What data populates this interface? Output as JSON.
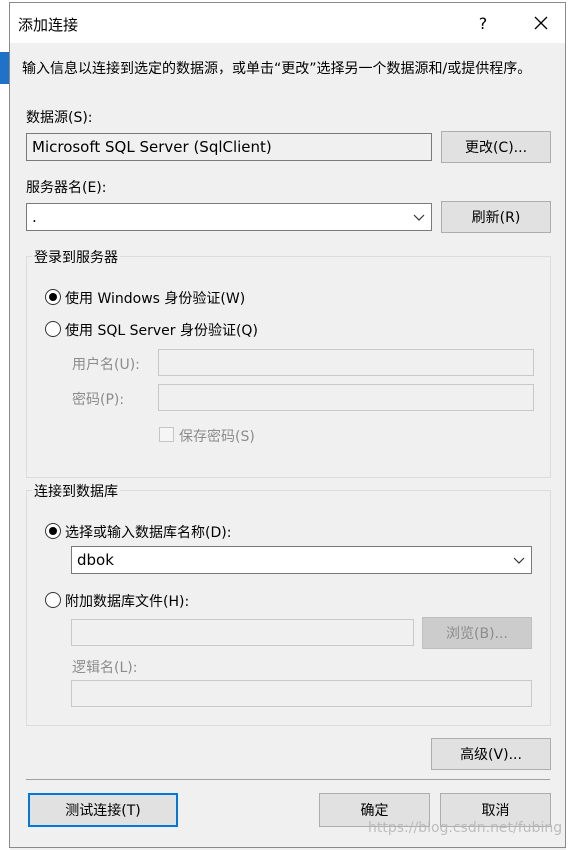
{
  "window": {
    "title": "添加连接",
    "help_label": "?",
    "instruction": "输入信息以连接到选定的数据源，或单击“更改”选择另一个数据源和/或提供程序。"
  },
  "data_source": {
    "label": "数据源(S):",
    "value": "Microsoft SQL Server (SqlClient)",
    "change_button": "更改(C)..."
  },
  "server": {
    "label": "服务器名(E):",
    "value": ".",
    "refresh_button": "刷新(R)"
  },
  "login_group": {
    "title": "登录到服务器",
    "windows_auth": {
      "label": "使用 Windows 身份验证(W)",
      "selected": true
    },
    "sql_auth": {
      "label": "使用 SQL Server 身份验证(Q)",
      "selected": false
    },
    "username_label": "用户名(U):",
    "username_value": "",
    "password_label": "密码(P):",
    "password_value": "",
    "save_password_label": "保存密码(S)"
  },
  "database_group": {
    "title": "连接到数据库",
    "select_db": {
      "label": "选择或输入数据库名称(D):",
      "selected": true,
      "value": "dbok"
    },
    "attach_file": {
      "label": "附加数据库文件(H):",
      "selected": false,
      "value": "",
      "browse_button": "浏览(B)..."
    },
    "logical_name_label": "逻辑名(L):",
    "logical_name_value": ""
  },
  "buttons": {
    "advanced": "高级(V)...",
    "test_connection": "测试连接(T)",
    "ok": "确定",
    "cancel": "取消"
  },
  "watermark": "https://blog.csdn.net/fubing",
  "colors": {
    "accent": "#0078d7",
    "disabled_text": "#8c8c8c",
    "dialog_bg": "#f0f0f0"
  }
}
